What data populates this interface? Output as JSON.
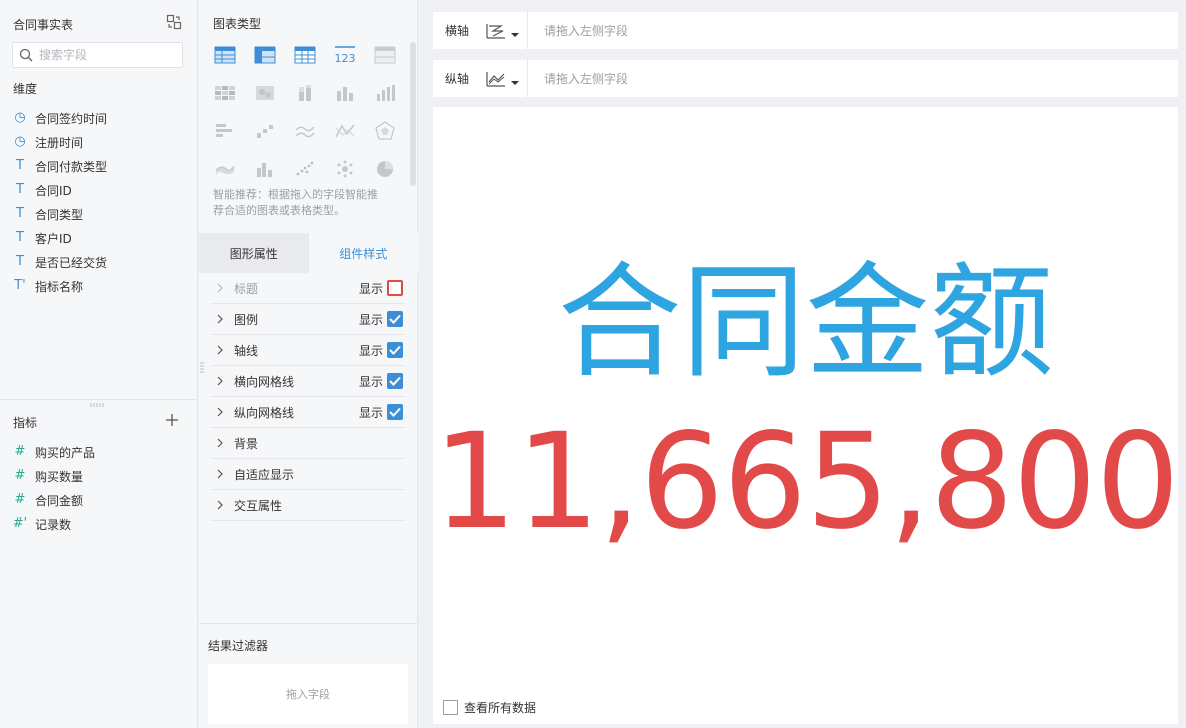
{
  "left_panel": {
    "dataset_title": "合同事实表",
    "search_placeholder": "搜索字段",
    "dimension_label": "维度",
    "dimensions": [
      {
        "name": "合同签约时间",
        "icon": "clock-icon",
        "glyph": "◷"
      },
      {
        "name": "注册时间",
        "icon": "clock-icon",
        "glyph": "◷"
      },
      {
        "name": "合同付款类型",
        "icon": "text-type-icon",
        "glyph": "T"
      },
      {
        "name": "合同ID",
        "icon": "text-type-icon",
        "glyph": "T"
      },
      {
        "name": "合同类型",
        "icon": "text-type-icon",
        "glyph": "T"
      },
      {
        "name": "客户ID",
        "icon": "text-type-icon",
        "glyph": "T"
      },
      {
        "name": "是否已经交货",
        "icon": "text-type-icon",
        "glyph": "T"
      },
      {
        "name": "指标名称",
        "icon": "calculated-text-icon",
        "glyph": "T'"
      }
    ],
    "measure_label": "指标",
    "measures": [
      {
        "name": "购买的产品",
        "icon": "number-type-icon",
        "glyph": "#"
      },
      {
        "name": "购买数量",
        "icon": "number-type-icon",
        "glyph": "#"
      },
      {
        "name": "合同金额",
        "icon": "number-type-icon",
        "glyph": "#"
      },
      {
        "name": "记录数",
        "icon": "calculated-number-icon",
        "glyph": "#'"
      }
    ]
  },
  "mid_panel": {
    "chart_type_label": "图表类型",
    "hint": "智能推荐：根据拖入的字段智能推荐合适的图表或表格类型。",
    "kpi_chart_label": "123",
    "tabs": [
      {
        "label": "图形属性",
        "active": false
      },
      {
        "label": "组件样式",
        "active": true
      }
    ],
    "properties": [
      {
        "label": "标题",
        "show_label": "显示",
        "checked": false,
        "has_checkbox": true,
        "disabled": true
      },
      {
        "label": "图例",
        "show_label": "显示",
        "checked": true,
        "has_checkbox": true,
        "disabled": false
      },
      {
        "label": "轴线",
        "show_label": "显示",
        "checked": true,
        "has_checkbox": true,
        "disabled": false
      },
      {
        "label": "横向网格线",
        "show_label": "显示",
        "checked": true,
        "has_checkbox": true,
        "disabled": false
      },
      {
        "label": "纵向网格线",
        "show_label": "显示",
        "checked": true,
        "has_checkbox": true,
        "disabled": false
      },
      {
        "label": "背景",
        "show_label": "",
        "checked": false,
        "has_checkbox": false,
        "disabled": false
      },
      {
        "label": "自适应显示",
        "show_label": "",
        "checked": false,
        "has_checkbox": false,
        "disabled": false
      },
      {
        "label": "交互属性",
        "show_label": "",
        "checked": false,
        "has_checkbox": false,
        "disabled": false
      }
    ],
    "filter_title": "结果过滤器",
    "filter_drop": "拖入字段"
  },
  "canvas": {
    "x_axis": {
      "label": "横轴",
      "placeholder": "请拖入左侧字段"
    },
    "y_axis": {
      "label": "纵轴",
      "placeholder": "请拖入左侧字段"
    },
    "kpi_title": "合同金额",
    "kpi_value": "11,665,800",
    "view_all_label": "查看所有数据"
  },
  "colors": {
    "accent": "#3c8fd6",
    "kpi_title": "#2ea4e0",
    "kpi_value": "#e24a4a",
    "measure_icon": "#2aa98f",
    "highlight_border": "#e24a4a"
  }
}
